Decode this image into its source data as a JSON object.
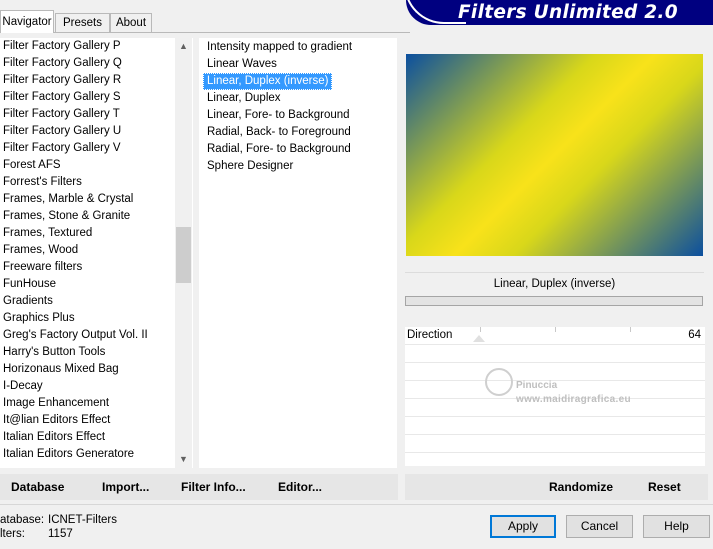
{
  "tabs": [
    "Navigator",
    "Presets",
    "About"
  ],
  "banner": "Filters Unlimited 2.0",
  "categories": [
    "Filter Factory Gallery P",
    "Filter Factory Gallery Q",
    "Filter Factory Gallery R",
    "Filter Factory Gallery S",
    "Filter Factory Gallery T",
    "Filter Factory Gallery U",
    "Filter Factory Gallery V",
    "Forest AFS",
    "Forrest's Filters",
    "Frames, Marble & Crystal",
    "Frames, Stone & Granite",
    "Frames, Textured",
    "Frames, Wood",
    "Freeware filters",
    "FunHouse",
    "Gradients",
    "Graphics Plus",
    "Greg's Factory Output Vol. II",
    "Harry's Button Tools",
    "Horizonaus Mixed Bag",
    "I-Decay",
    "Image Enhancement",
    "It@lian Editors Effect",
    "Italian Editors Effect",
    "Italian Editors Generatore"
  ],
  "scroll_up_icon": "chevron-up-icon",
  "scroll_down_icon": "chevron-down-icon",
  "filters": [
    "Intensity mapped to gradient",
    "Linear Waves",
    "Linear, Duplex (inverse)",
    "Linear, Duplex",
    "Linear, Fore- to Background",
    "Radial, Back- to Foreground",
    "Radial, Fore- to Background",
    "Sphere Designer"
  ],
  "selected_filter_index": 2,
  "filter_name": "Linear, Duplex (inverse)",
  "slider": {
    "label": "Direction",
    "value": "64"
  },
  "watermark": {
    "line1": "Pinuccia",
    "line2": "www.maidiragrafica.eu"
  },
  "actions_left": [
    "Database",
    "Import...",
    "Filter Info...",
    "Editor..."
  ],
  "actions_right": [
    "Randomize",
    "Reset"
  ],
  "info": {
    "database_label": "atabase:",
    "database_value": "ICNET-Filters",
    "filters_label": "lters:",
    "filters_value": "1157"
  },
  "buttons": {
    "apply": "Apply",
    "cancel": "Cancel",
    "help": "Help"
  },
  "colors": {
    "banner": "#000080",
    "selection": "#3399ff",
    "gradient_blue": "#0b4f9f",
    "gradient_yellow": "#f8e21a"
  }
}
